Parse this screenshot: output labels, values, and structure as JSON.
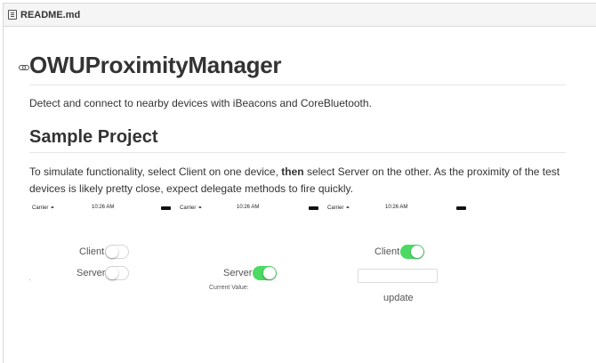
{
  "file": {
    "name": "README.md",
    "icon": "file-icon"
  },
  "title": "OWUProximityManager",
  "intro": "Detect and connect to nearby devices with iBeacons and CoreBluetooth.",
  "section": "Sample Project",
  "paragraph": {
    "before": "To simulate functionality, select Client on one device, ",
    "bold": "then",
    "after": " select Server on the other. As the proximity of the test devices is likely pretty close, expect delegate methods to fire quickly."
  },
  "devices": [
    {
      "carrier": "Carrier",
      "time": "10:26 AM"
    },
    {
      "carrier": "Carrier",
      "time": "10:26 AM"
    },
    {
      "carrier": "Carrier",
      "time": "10:26 AM"
    }
  ],
  "device1": {
    "client_label": "Client",
    "client_on": false,
    "server_label": "Server",
    "server_on": false
  },
  "device2": {
    "server_label": "Server",
    "server_on": true,
    "current_value_label": "Current Value:"
  },
  "device3": {
    "client_label": "Client",
    "client_on": true,
    "field_value": "",
    "update_label": "update"
  },
  "colors": {
    "toggle_on": "#4cd964",
    "text": "#333333"
  }
}
